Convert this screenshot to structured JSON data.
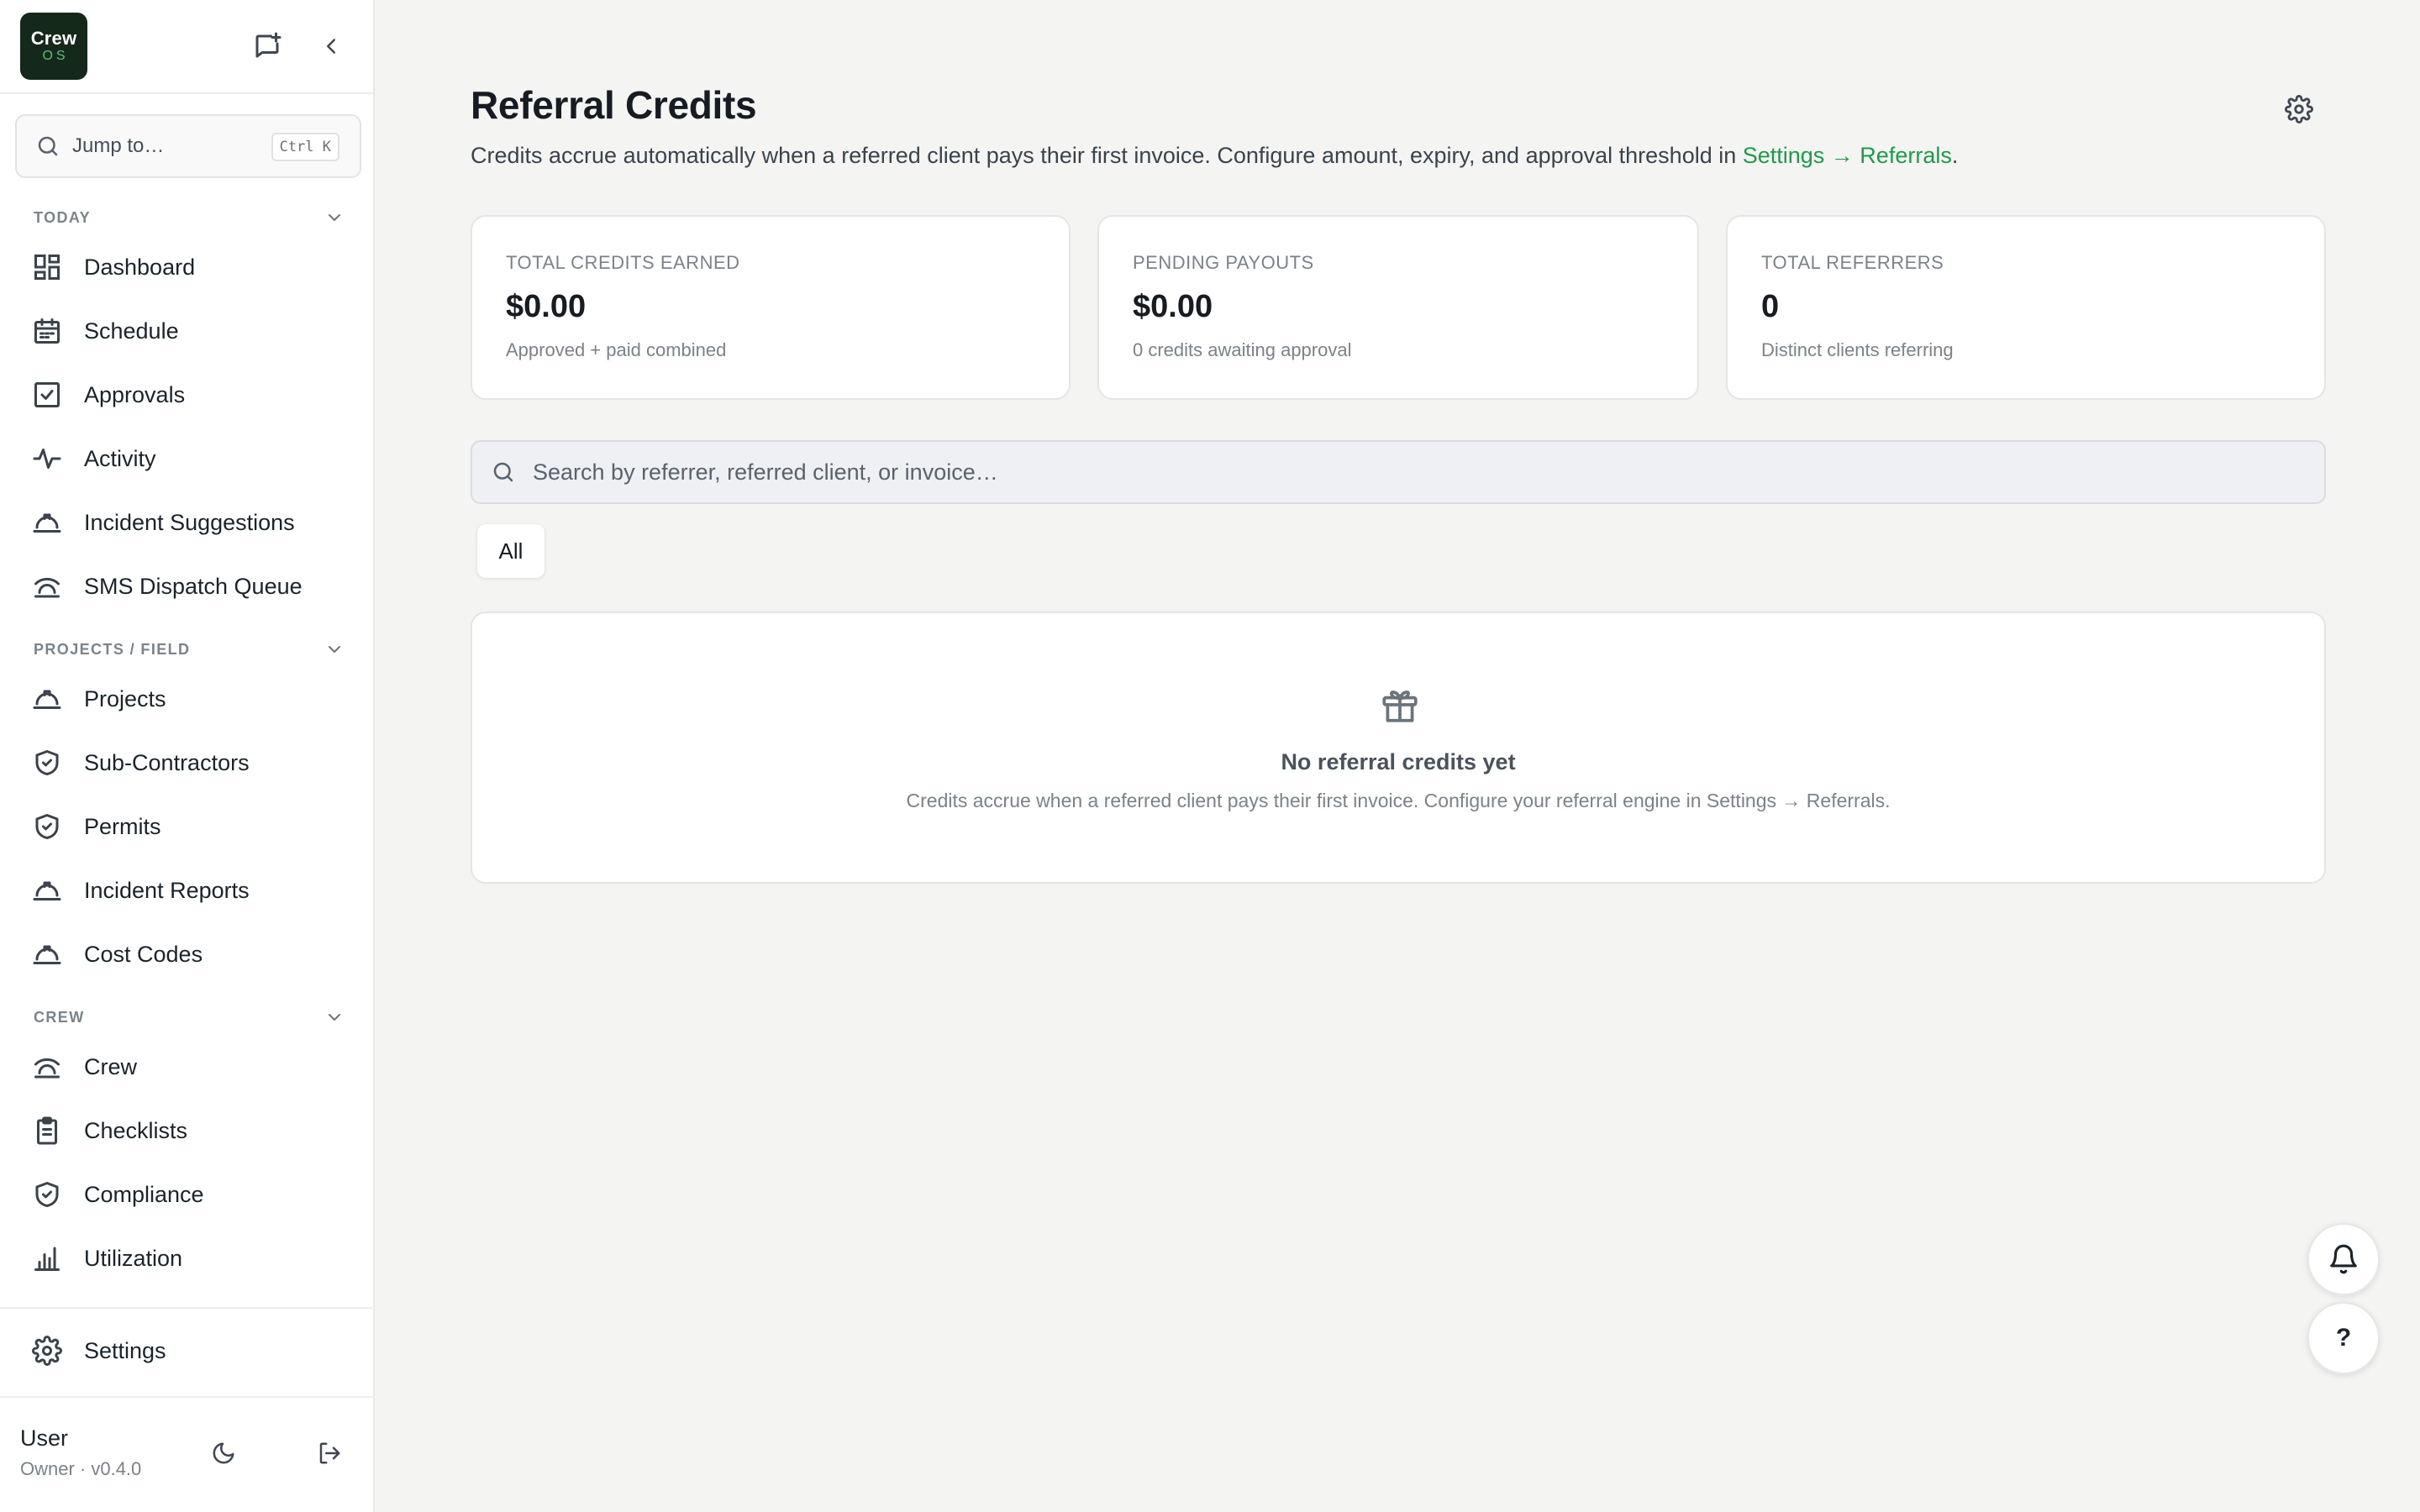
{
  "brand": {
    "line1": "Crew",
    "line2": "OS"
  },
  "sidebar": {
    "jump_placeholder": "Jump to…",
    "jump_shortcut": "Ctrl K",
    "sections": [
      {
        "title": "TODAY",
        "items": [
          {
            "label": "Dashboard",
            "icon": "dashboard-icon"
          },
          {
            "label": "Schedule",
            "icon": "calendar-icon"
          },
          {
            "label": "Approvals",
            "icon": "check-square-icon"
          },
          {
            "label": "Activity",
            "icon": "activity-icon"
          },
          {
            "label": "Incident Suggestions",
            "icon": "hard-hat-icon"
          },
          {
            "label": "SMS Dispatch Queue",
            "icon": "dispatch-icon"
          }
        ]
      },
      {
        "title": "PROJECTS / FIELD",
        "items": [
          {
            "label": "Projects",
            "icon": "hard-hat-icon"
          },
          {
            "label": "Sub-Contractors",
            "icon": "shield-check-icon"
          },
          {
            "label": "Permits",
            "icon": "shield-check-icon"
          },
          {
            "label": "Incident Reports",
            "icon": "hard-hat-icon"
          },
          {
            "label": "Cost Codes",
            "icon": "hard-hat-icon"
          }
        ]
      },
      {
        "title": "CREW",
        "items": [
          {
            "label": "Crew",
            "icon": "dispatch-icon"
          },
          {
            "label": "Checklists",
            "icon": "clipboard-icon"
          },
          {
            "label": "Compliance",
            "icon": "shield-check-icon"
          },
          {
            "label": "Utilization",
            "icon": "bar-chart-icon"
          }
        ]
      }
    ],
    "settings_label": "Settings",
    "user": {
      "name": "User",
      "role": "Owner · v0.4.0"
    }
  },
  "page": {
    "title": "Referral Credits",
    "desc_prefix": "Credits accrue automatically when a referred client pays their first invoice. Configure amount, expiry, and approval threshold in ",
    "desc_link": "Settings → Referrals",
    "desc_suffix": "."
  },
  "stats": [
    {
      "label": "TOTAL CREDITS EARNED",
      "value": "$0.00",
      "sub": "Approved + paid combined"
    },
    {
      "label": "PENDING PAYOUTS",
      "value": "$0.00",
      "sub": "0 credits awaiting approval"
    },
    {
      "label": "TOTAL REFERRERS",
      "value": "0",
      "sub": "Distinct clients referring"
    }
  ],
  "search": {
    "placeholder": "Search by referrer, referred client, or invoice…"
  },
  "filters": {
    "all": "All"
  },
  "empty": {
    "title": "No referral credits yet",
    "desc": "Credits accrue when a referred client pays their first invoice. Configure your referral engine in Settings → Referrals."
  },
  "help_label": "?",
  "colors": {
    "accent": "#1f9a4a",
    "brand_bg": "#15291b",
    "background": "#f4f5f3"
  }
}
